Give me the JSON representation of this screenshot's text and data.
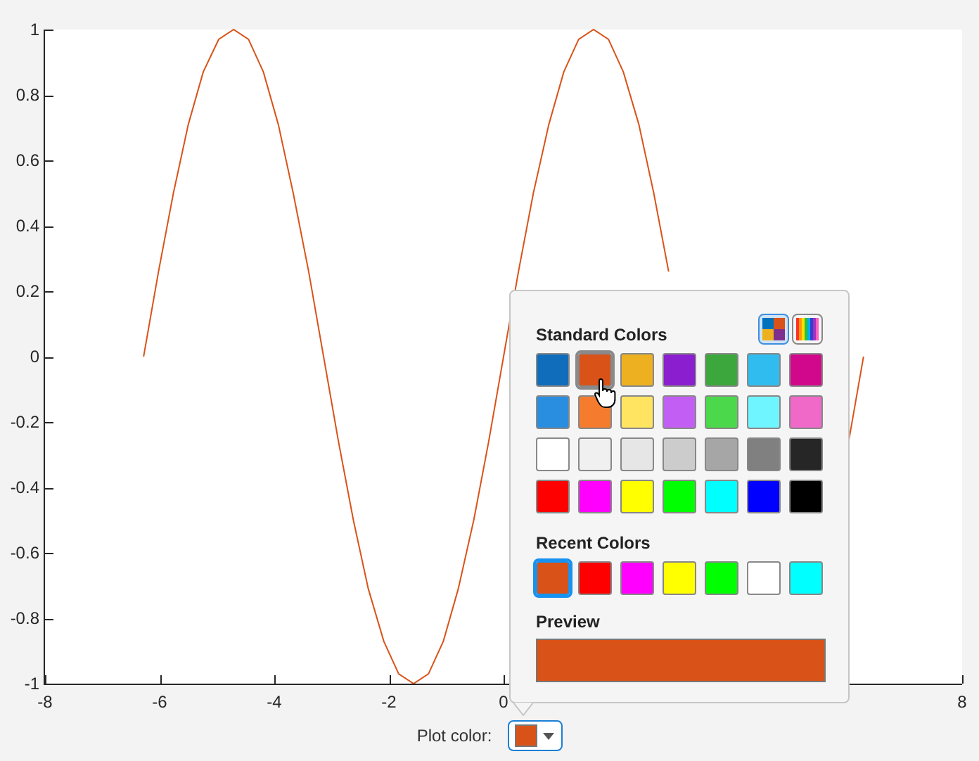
{
  "chart": {
    "chart_data": {
      "type": "line",
      "xlim": [
        -8,
        8
      ],
      "ylim": [
        -1,
        1
      ],
      "xticks": [
        -8,
        -6,
        -4,
        -2,
        0,
        8
      ],
      "yticks": [
        -1,
        -0.8,
        -0.6,
        -0.4,
        -0.2,
        0,
        0.2,
        0.4,
        0.6,
        0.8,
        1
      ],
      "x": [
        -6.28,
        -6.02,
        -5.76,
        -5.5,
        -5.24,
        -4.97,
        -4.71,
        -4.45,
        -4.19,
        -3.93,
        -3.67,
        -3.4,
        -3.14,
        -2.88,
        -2.62,
        -2.36,
        -2.09,
        -1.83,
        -1.57,
        -1.31,
        -1.05,
        -0.79,
        -0.52,
        -0.26,
        0,
        0.26,
        0.52,
        0.79,
        1.05,
        1.31,
        1.57,
        1.83,
        2.09,
        2.36,
        2.62,
        2.88,
        6.02,
        6.28
      ],
      "series": [
        {
          "color": "#d95319",
          "values": [
            0,
            0.26,
            0.5,
            0.71,
            0.87,
            0.97,
            1,
            0.97,
            0.87,
            0.71,
            0.5,
            0.26,
            0,
            -0.26,
            -0.5,
            -0.71,
            -0.87,
            -0.97,
            -1,
            -0.97,
            -0.87,
            -0.71,
            -0.5,
            -0.26,
            0,
            0.26,
            0.5,
            0.71,
            0.87,
            0.97,
            1,
            0.97,
            0.87,
            0.71,
            0.5,
            0.26,
            -0.26,
            0
          ]
        }
      ]
    }
  },
  "color_picker": {
    "standard_title": "Standard Colors",
    "modes": [
      {
        "kind": "swatches",
        "selected": true
      },
      {
        "kind": "spectrum",
        "selected": false
      }
    ],
    "standard_colors": [
      {
        "color": "#0f6dbb",
        "selected": false
      },
      {
        "color": "#d95319",
        "selected": true
      },
      {
        "color": "#ecb021",
        "selected": false
      },
      {
        "color": "#8b1ecf",
        "selected": false
      },
      {
        "color": "#3ca73c",
        "selected": false
      },
      {
        "color": "#30bcee",
        "selected": false
      },
      {
        "color": "#d1088b",
        "selected": false
      },
      {
        "color": "#2a8ee0",
        "selected": false
      },
      {
        "color": "#f57c2e",
        "selected": false
      },
      {
        "color": "#ffe462",
        "selected": false
      },
      {
        "color": "#c35ef5",
        "selected": false
      },
      {
        "color": "#4bd84b",
        "selected": false
      },
      {
        "color": "#6ef5ff",
        "selected": false
      },
      {
        "color": "#f068c8",
        "selected": false
      },
      {
        "color": "#ffffff",
        "selected": false
      },
      {
        "color": "#f0f0f0",
        "selected": false
      },
      {
        "color": "#e6e6e6",
        "selected": false
      },
      {
        "color": "#cccccc",
        "selected": false
      },
      {
        "color": "#a6a6a6",
        "selected": false
      },
      {
        "color": "#808080",
        "selected": false
      },
      {
        "color": "#262626",
        "selected": false
      },
      {
        "color": "#ff0000",
        "selected": false
      },
      {
        "color": "#ff00ff",
        "selected": false
      },
      {
        "color": "#ffff00",
        "selected": false
      },
      {
        "color": "#00ff00",
        "selected": false
      },
      {
        "color": "#00ffff",
        "selected": false
      },
      {
        "color": "#0000ff",
        "selected": false
      },
      {
        "color": "#000000",
        "selected": false
      }
    ],
    "recent_title": "Recent Colors",
    "recent_colors": [
      {
        "color": "#d95319",
        "selected": true
      },
      {
        "color": "#ff0000",
        "selected": false
      },
      {
        "color": "#ff00ff",
        "selected": false
      },
      {
        "color": "#ffff00",
        "selected": false
      },
      {
        "color": "#00ff00",
        "selected": false
      },
      {
        "color": "#ffffff",
        "selected": false
      },
      {
        "color": "#00ffff",
        "selected": false
      }
    ],
    "preview_title": "Preview",
    "preview": {
      "color": "#d95319"
    }
  },
  "plot_color": {
    "label": "Plot color:",
    "color": "#d95319",
    "expanded": true
  }
}
